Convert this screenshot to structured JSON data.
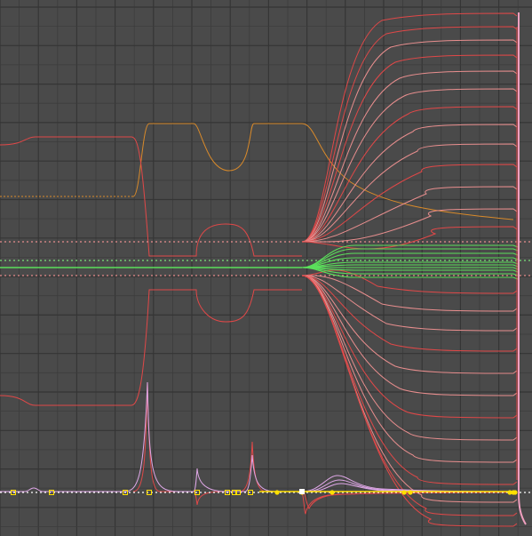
{
  "editor": {
    "name": "animation-graph-editor",
    "background": "#4a4a4a"
  },
  "colors": {
    "grid_minor": "#3c3c3c",
    "grid_major": "#353535",
    "curve_red": "#e04848",
    "curve_salmon": "#e88e8e",
    "curve_pink": "#f0a0c0",
    "curve_orange": "#d98a2a",
    "curve_green": "#5be05b",
    "curve_lilac": "#e0a8e8",
    "keyframe_yellow": "#ffe000",
    "keyframe_white": "#ffffff",
    "selected_curve": "#ffb0c8"
  },
  "timeline": {
    "current_frame_indicator": "vertical-line-pink"
  }
}
